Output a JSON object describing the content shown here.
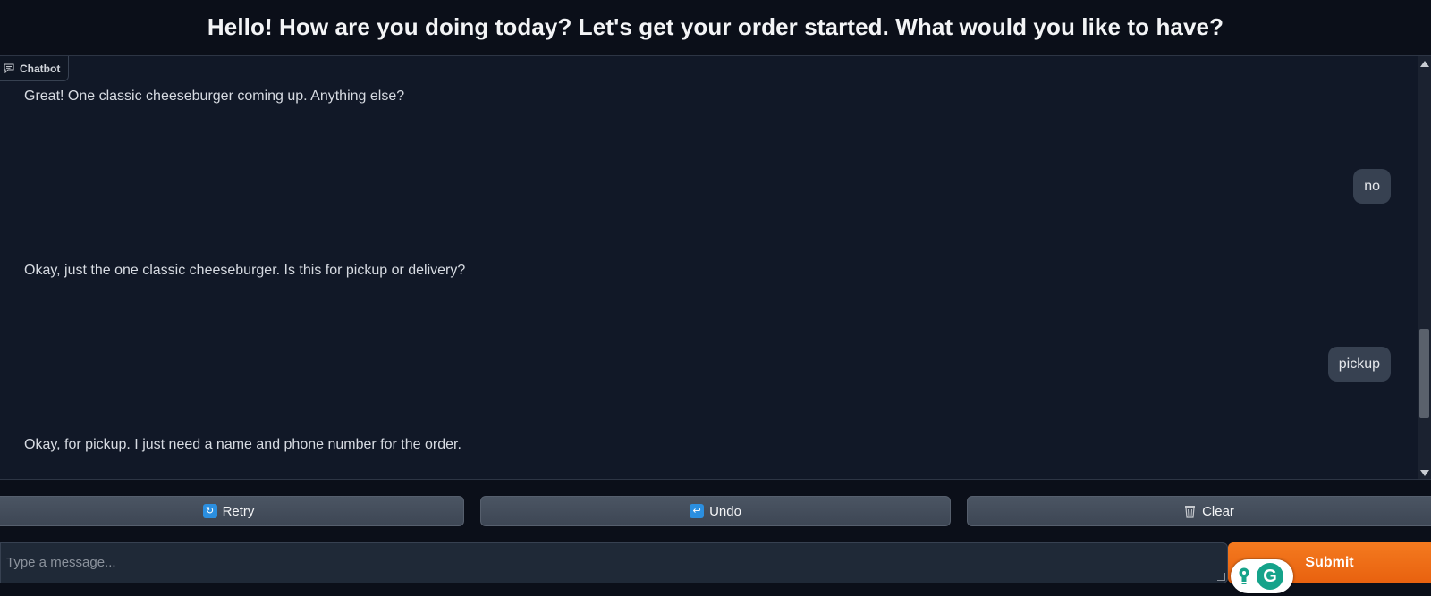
{
  "header": {
    "title": "Hello! How are you doing today? Let's get your order started. What would you like to have?"
  },
  "chatbot": {
    "label": "Chatbot",
    "messages": [
      {
        "role": "bot",
        "text": "Great! One classic cheeseburger coming up. Anything else?"
      },
      {
        "role": "user",
        "text": "no"
      },
      {
        "role": "bot",
        "text": "Okay, just the one classic cheeseburger. Is this for pickup or delivery?"
      },
      {
        "role": "user",
        "text": "pickup"
      },
      {
        "role": "bot",
        "text": "Okay, for pickup. I just need a name and phone number for the order."
      }
    ]
  },
  "buttons": {
    "retry": {
      "label": "Retry",
      "icon": "retry-icon"
    },
    "undo": {
      "label": "Undo",
      "icon": "undo-icon"
    },
    "clear": {
      "label": "Clear",
      "icon": "wastebasket-icon"
    }
  },
  "input": {
    "placeholder": "Type a message...",
    "value": ""
  },
  "submit": {
    "label": "Submit",
    "color": "#f47a1f"
  },
  "grammarly": {
    "logo_letter": "G",
    "color": "#15a38a"
  }
}
